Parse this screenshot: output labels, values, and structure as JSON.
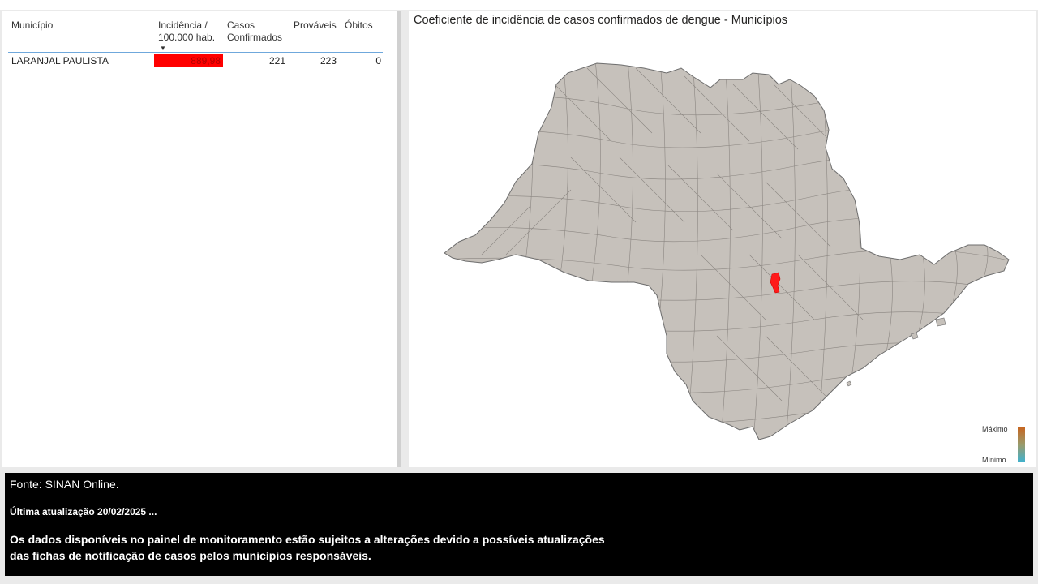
{
  "table": {
    "columns": {
      "municipio": "Município",
      "incidencia": "Incidência / 100.000 hab.",
      "confirmados": "Casos Confirmados",
      "provaveis": "Prováveis",
      "obitos": "Óbitos"
    },
    "sort_indicator": "▼",
    "rows": [
      {
        "municipio": "LARANJAL PAULISTA",
        "incidencia": "889,98",
        "confirmados": "221",
        "provaveis": "223",
        "obitos": "0"
      }
    ],
    "highlight_color": "#ff0000"
  },
  "map": {
    "title": "Coeficiente de incidência de casos confirmados de dengue - Municípios",
    "fill_color": "#c6c1bb",
    "border_color": "#6d6d6d",
    "highlight_color": "#ff1a1a",
    "legend": {
      "max_label": "Máximo",
      "min_label": "Mínimo"
    }
  },
  "footer": {
    "source": "Fonte: SINAN Online.",
    "updated": "Última atualização 20/02/2025 ...",
    "note": "Os dados disponíveis no painel de monitoramento estão sujeitos a alterações devido a possíveis atualizações das fichas de notificação de casos pelos municípios responsáveis."
  }
}
